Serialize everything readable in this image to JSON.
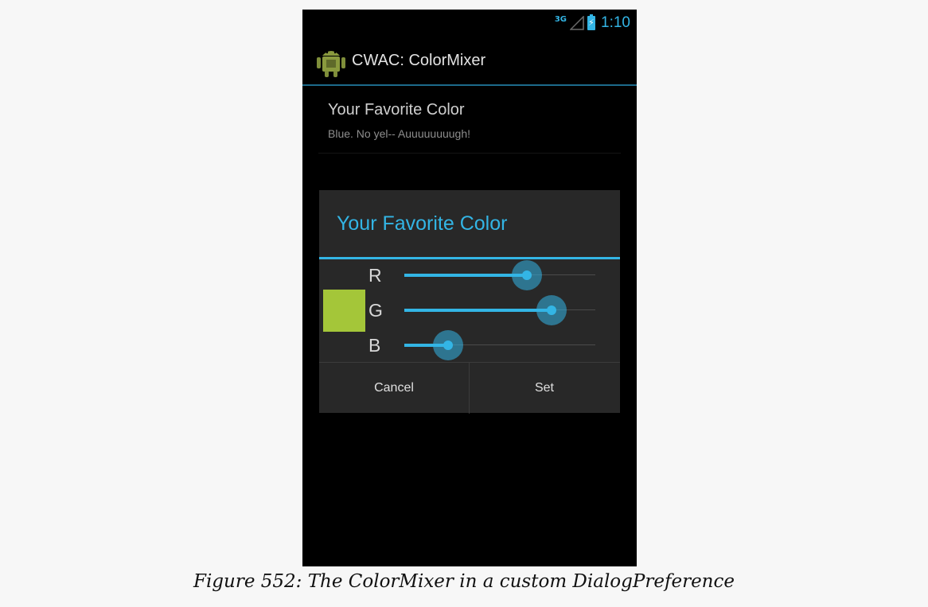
{
  "status_bar": {
    "network": "3G",
    "time": "1:10",
    "icons": [
      "signal-icon",
      "battery-charging-icon"
    ]
  },
  "action_bar": {
    "icon": "android-app-icon",
    "title": "CWAC: ColorMixer"
  },
  "preference": {
    "title": "Your Favorite Color",
    "summary": "Blue.  No yel--  Auuuuuuuugh!"
  },
  "dialog": {
    "title": "Your Favorite Color",
    "swatch_color": "#a4c639",
    "channels": [
      {
        "label": "R",
        "value": 0.64
      },
      {
        "label": "G",
        "value": 0.77
      },
      {
        "label": "B",
        "value": 0.23
      }
    ],
    "buttons": {
      "cancel": "Cancel",
      "set": "Set"
    }
  },
  "colors": {
    "accent": "#33b5e5",
    "background": "#000000",
    "dialog": "#282828"
  },
  "caption": "Figure 552: The ColorMixer in a custom DialogPreference"
}
